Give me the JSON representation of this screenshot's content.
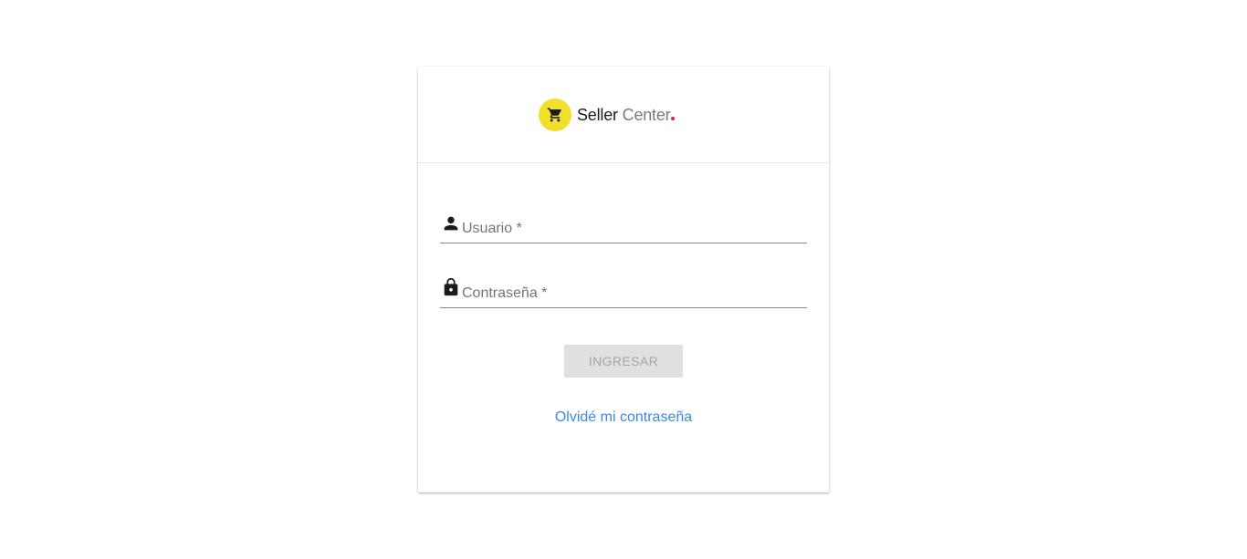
{
  "brand": {
    "word1": "Seller",
    "word2": "Center",
    "circle_color": "#f2df2c",
    "dot_color": "#d9262c",
    "icon": "shopping-cart-icon"
  },
  "form": {
    "username": {
      "label": "Usuario *",
      "value": "",
      "icon": "person-icon"
    },
    "password": {
      "label": "Contraseña *",
      "value": "",
      "icon": "lock-icon"
    },
    "submit_label": "INGRESAR",
    "submit_disabled": true,
    "forgot_link": "Olvidé mi contraseña"
  },
  "colors": {
    "link": "#3f86e8",
    "button_bg": "#e0e0e0",
    "button_text": "#a6a6a6"
  }
}
